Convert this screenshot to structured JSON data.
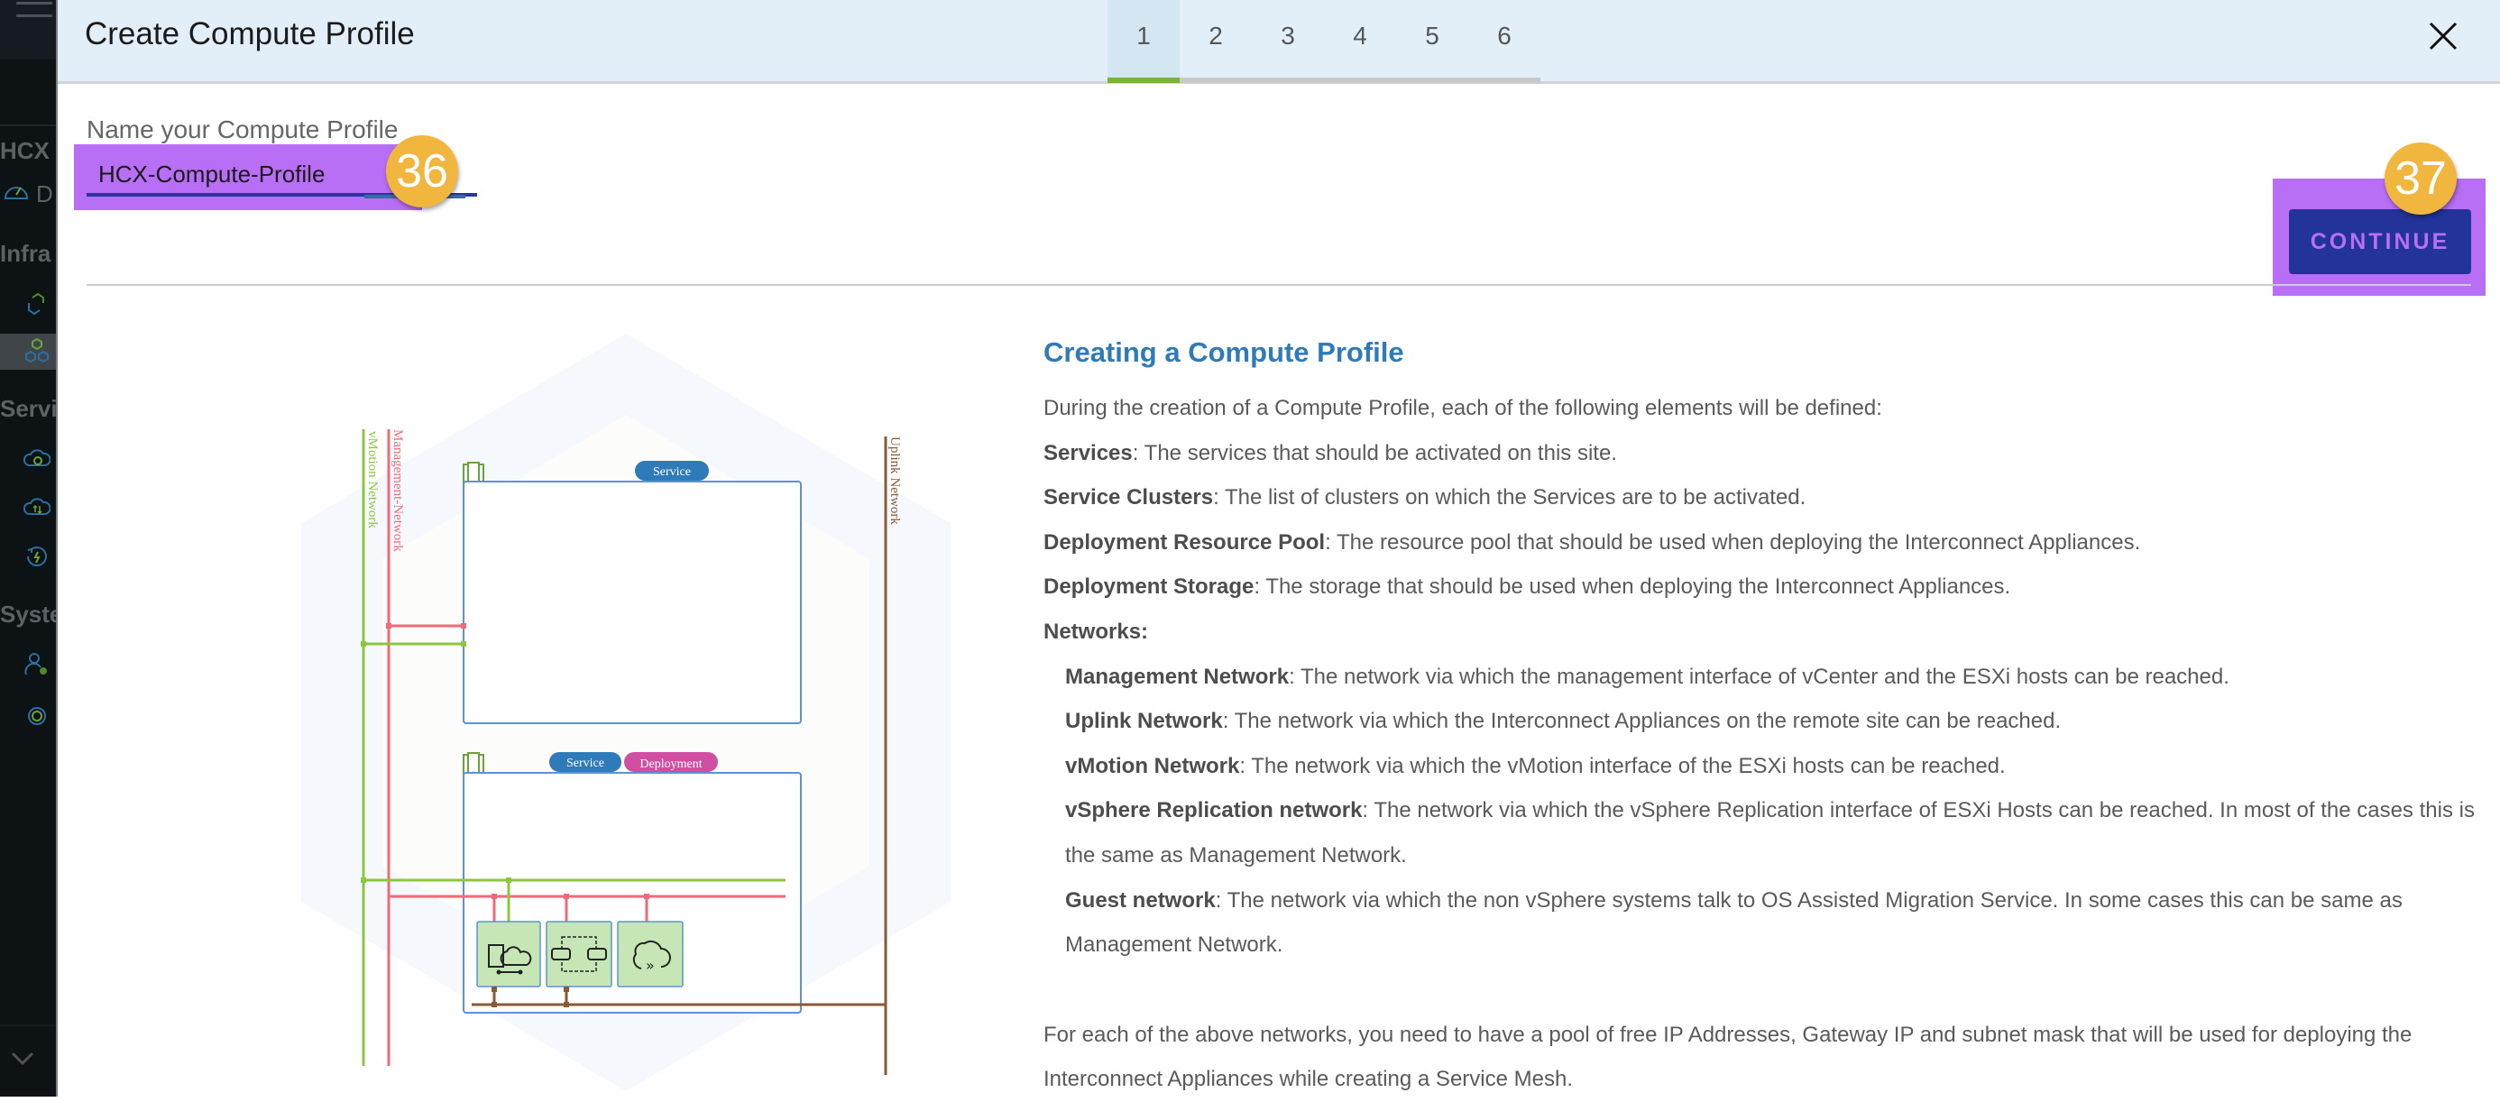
{
  "sidebar": {
    "app_label": "HCX",
    "dashboard_label": "D",
    "sections": [
      {
        "label": "Infra"
      },
      {
        "label": "Servi"
      },
      {
        "label": "Syste"
      }
    ],
    "icons": [
      "dashboard-icon",
      "site-pairing-icon",
      "interconnect-icon",
      "network-extension-icon",
      "migration-icon",
      "disaster-recovery-icon",
      "admin-settings-icon",
      "support-icon"
    ],
    "collapse_icon": "chevron-down-icon"
  },
  "modal": {
    "title": "Create Compute Profile",
    "steps": [
      {
        "label": "1",
        "active": true
      },
      {
        "label": "2",
        "active": false
      },
      {
        "label": "3",
        "active": false
      },
      {
        "label": "4",
        "active": false
      },
      {
        "label": "5",
        "active": false
      },
      {
        "label": "6",
        "active": false
      }
    ],
    "step_progress": "1/6",
    "close_icon": "close-icon",
    "name_field": {
      "label": "Name your Compute Profile",
      "value": "HCX-Compute-Profile"
    },
    "continue_label": "CONTINUE",
    "annotations": {
      "badge_input": "36",
      "badge_continue": "37"
    }
  },
  "diagram": {
    "networks": {
      "vmotion": "vMotion Network",
      "management": "Management-Network",
      "uplink": "Uplink Network"
    },
    "cluster_top": {
      "tags": [
        "Service"
      ]
    },
    "cluster_bottom": {
      "tags": [
        "Service",
        "Deployment"
      ]
    },
    "appliances": [
      "interconnect-appliance-icon",
      "network-extension-appliance-icon",
      "wan-optimization-appliance-icon"
    ],
    "colors": {
      "vmotion": "#8cc63f",
      "management": "#ee6a78",
      "uplink": "#8a5a36",
      "cluster_border": "#5b93d6",
      "service_tag": "#2f7ab8",
      "deployment_tag": "#d04fa3",
      "appliance_fill": "#c7e6b6"
    }
  },
  "description": {
    "heading": "Creating a Compute Profile",
    "intro": "During the creation of a Compute Profile, each of the following elements will be defined:",
    "items": [
      {
        "term": "Services",
        "text": ": The services that should be activated on this site."
      },
      {
        "term": "Service Clusters",
        "text": ": The list of clusters on which the Services are to be activated."
      },
      {
        "term": "Deployment Resource Pool",
        "text": ": The resource pool that should be used when deploying the Interconnect Appliances."
      },
      {
        "term": "Deployment Storage",
        "text": ": The storage that should be used when deploying the Interconnect Appliances."
      }
    ],
    "networks_heading": "Networks:",
    "networks": [
      {
        "term": "Management Network",
        "text": ": The network via which the management interface of vCenter and the ESXi hosts can be reached."
      },
      {
        "term": "Uplink Network",
        "text": ": The network via which the Interconnect Appliances on the remote site can be reached."
      },
      {
        "term": "vMotion Network",
        "text": ": The network via which the vMotion interface of the ESXi hosts can be reached."
      },
      {
        "term": "vSphere Replication network",
        "text": ": The network via which the vSphere Replication interface of ESXi Hosts can be reached. In most of the cases this is the same as Management Network."
      },
      {
        "term": "Guest network",
        "text": ": The network via which the non vSphere systems talk to OS Assisted Migration Service. In some cases this can be same as Management Network."
      }
    ],
    "footer": "For each of the above networks, you need to have a pool of free IP Addresses, Gateway IP and subnet mask that will be used for deploying the Interconnect Appliances while creating a Service Mesh."
  },
  "colors": {
    "header_bg": "#e2eff8",
    "accent_green": "#7cb33d",
    "primary_button": "#22339a",
    "heading_blue": "#2f7ab8",
    "annotation_purple": "#b86ef5",
    "annotation_badge": "#f0b63d"
  }
}
